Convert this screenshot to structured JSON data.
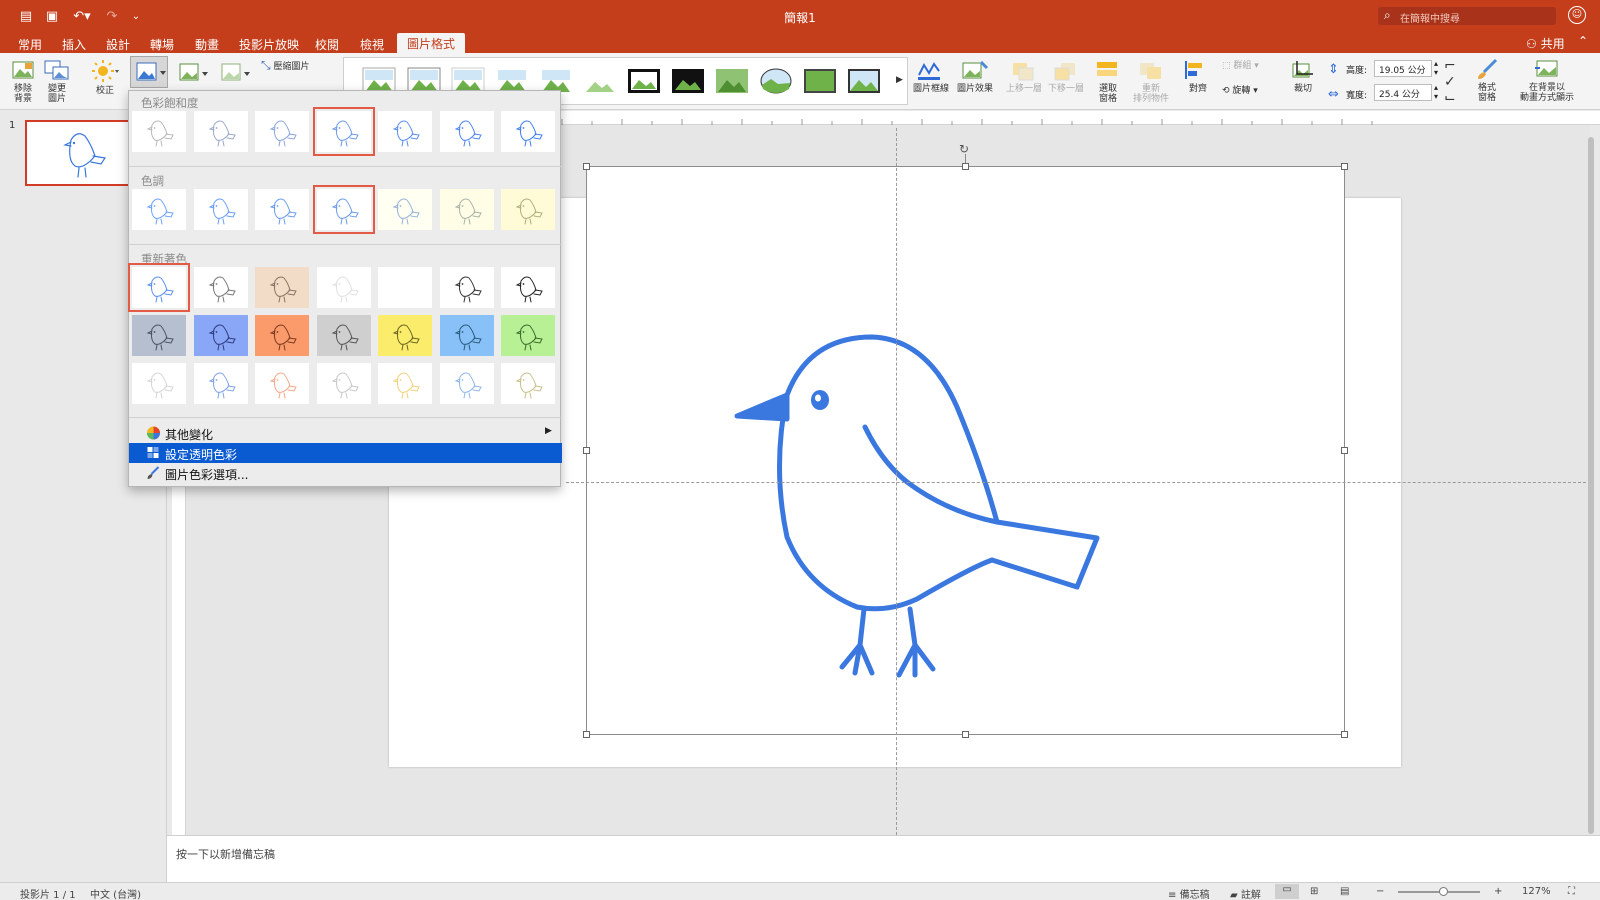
{
  "window": {
    "title": "簡報1",
    "search_placeholder": "在簡報中搜尋"
  },
  "tabs": [
    "常用",
    "插入",
    "設計",
    "轉場",
    "動畫",
    "投影片放映",
    "校閱",
    "檢視",
    "圖片格式"
  ],
  "active_tab": "圖片格式",
  "share_label": "共用",
  "ribbon": {
    "remove_bg": "移除\n背景",
    "change_pic": "變更\n圖片",
    "corrections": "校正",
    "compress": "壓縮圖片",
    "pic_border": "圖片框線",
    "pic_effects": "圖片效果",
    "bring_forward": "上移一層",
    "send_backward": "下移一層",
    "selection_pane": "選取\n窗格",
    "reorder": "重新\n排列物件",
    "align": "對齊",
    "group": "群組",
    "rotate": "旋轉",
    "crop": "裁切",
    "height_label": "高度:",
    "height_value": "19.05 公分",
    "width_label": "寬度:",
    "width_value": "25.4 公分",
    "format_pane": "格式\n窗格",
    "animate_bg": "在背景以\n動畫方式顯示"
  },
  "menu": {
    "saturation_title": "色彩飽和度",
    "tone_title": "色調",
    "recolor_title": "重新著色",
    "more_variations": "其他變化",
    "set_transparent": "設定透明色彩",
    "color_options": "圖片色彩選項...",
    "swatch_bgs": {
      "saturation": [
        "#ffffff",
        "#ffffff",
        "#ffffff",
        "#ffffff",
        "#ffffff",
        "#ffffff",
        "#ffffff"
      ],
      "tone": [
        "#ffffff",
        "#ffffff",
        "#ffffff",
        "#ffffff",
        "#fffff2",
        "#fffde6",
        "#fffbd6"
      ],
      "recolor1": [
        "#ffffff",
        "#ffffff",
        "#f2dcc8",
        "#ffffff",
        "#ffffff",
        "#ffffff",
        "#ffffff"
      ],
      "recolor2": [
        "#b6bfcf",
        "#8aa6f6",
        "#fb9a6b",
        "#cfcfcf",
        "#fbed6b",
        "#87c1f7",
        "#b8f195"
      ],
      "recolor3": [
        "#ffffff",
        "#ffffff",
        "#ffffff",
        "#ffffff",
        "#ffffff",
        "#ffffff",
        "#ffffff"
      ]
    },
    "bird_colors": {
      "saturation": [
        "#b9b9b9",
        "#9aa9cc",
        "#8ca6df",
        "#6f9ae8",
        "#5b8eef",
        "#4d86f2",
        "#3f7ef5"
      ],
      "tone": [
        "#6fa2ff",
        "#6b9ef8",
        "#6a9cf2",
        "#6c9ce8",
        "#95b3d8",
        "#a8b5a8",
        "#b0ad7e"
      ],
      "recolor1": [
        "#5c8ef0",
        "#777777",
        "#8a7260",
        "#e0e0e0",
        "#ffffff",
        "#333333",
        "#222222"
      ],
      "recolor2": [
        "#4a5363",
        "#2b3d80",
        "#7b3a20",
        "#555555",
        "#6a6420",
        "#2c5a80",
        "#3a6a2a"
      ],
      "recolor3": [
        "#d5d5d5",
        "#7fa3e8",
        "#f3a98a",
        "#c8c8c8",
        "#f2d17a",
        "#8fb8ea",
        "#c8c08a"
      ]
    }
  },
  "slide_panel": {
    "slide_number": "1"
  },
  "notes_placeholder": "按一下以新增備忘稿",
  "status": {
    "slide_count": "投影片 1 / 1",
    "language": "中文 (台灣)",
    "notes_btn": "備忘稿",
    "comments_btn": "註解",
    "zoom_minus": "−",
    "zoom_plus": "+",
    "zoom": "127%",
    "zoom_fraction": 0.55
  },
  "colors": {
    "accent": "#c43e1c",
    "bird": "#3a78e0",
    "highlight": "#0a5bd1",
    "selected_outline": "#e35b47"
  }
}
